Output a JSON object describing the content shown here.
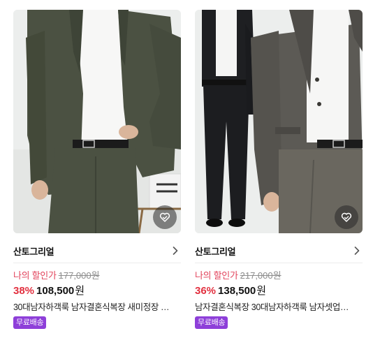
{
  "products": [
    {
      "shop_name": "산토그리얼",
      "my_price_label": "나의 할인가",
      "original_price": "177,000원",
      "discount_percent": "38%",
      "sale_price": "108,500",
      "currency": "원",
      "title": "30대남자하객룩 남자결혼식복장 새미정장 …",
      "badge": "무료배송",
      "suit_color": "#4b5142"
    },
    {
      "shop_name": "산토그리얼",
      "my_price_label": "나의 할인가",
      "original_price": "217,000원",
      "discount_percent": "36%",
      "sale_price": "138,500",
      "currency": "원",
      "title": "남자결혼식복장 30대남자하객룩 남자셋업…",
      "badge": "무료배송",
      "suit_color": "#5c5a55"
    }
  ],
  "colors": {
    "accent_red": "#e2303f",
    "badge_purple": "#8e3fd9"
  }
}
